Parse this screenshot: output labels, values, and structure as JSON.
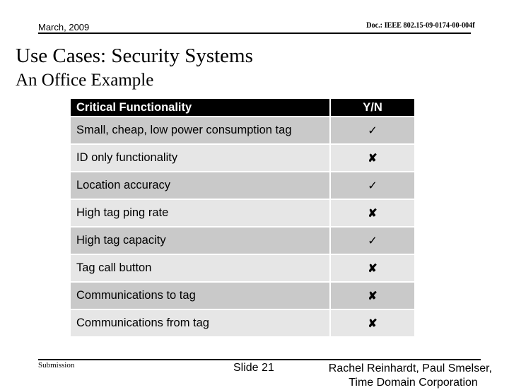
{
  "header": {
    "date": "March, 2009",
    "doc_id": "Doc.: IEEE 802.15-09-0174-00-004f"
  },
  "slide": {
    "title": "Use Cases: Security Systems",
    "subtitle": "An Office Example"
  },
  "table": {
    "columns": [
      "Critical Functionality",
      "Y/N"
    ],
    "rows": [
      {
        "feature": "Small, cheap, low power consumption tag",
        "value": "yes",
        "icon": "check-icon",
        "glyph": "✓"
      },
      {
        "feature": "ID only functionality",
        "value": "no",
        "icon": "cross-icon",
        "glyph": "✘"
      },
      {
        "feature": "Location accuracy",
        "value": "yes",
        "icon": "check-icon",
        "glyph": "✓"
      },
      {
        "feature": "High tag ping rate",
        "value": "no",
        "icon": "cross-icon",
        "glyph": "✘"
      },
      {
        "feature": "High tag capacity",
        "value": "yes",
        "icon": "check-icon",
        "glyph": "✓"
      },
      {
        "feature": "Tag call button",
        "value": "no",
        "icon": "cross-icon",
        "glyph": "✘"
      },
      {
        "feature": "Communications to tag",
        "value": "no",
        "icon": "cross-icon",
        "glyph": "✘"
      },
      {
        "feature": "Communications from tag",
        "value": "no",
        "icon": "cross-icon",
        "glyph": "✘"
      }
    ]
  },
  "footer": {
    "left": "Submission",
    "slide": "Slide 21",
    "authors_line1": "Rachel Reinhardt, Paul Smelser,",
    "authors_line2": "Time Domain Corporation"
  },
  "colors": {
    "header_row_bg": "#000000",
    "row_dark_bg": "#c9c9c9",
    "row_light_bg": "#e6e6e6"
  }
}
